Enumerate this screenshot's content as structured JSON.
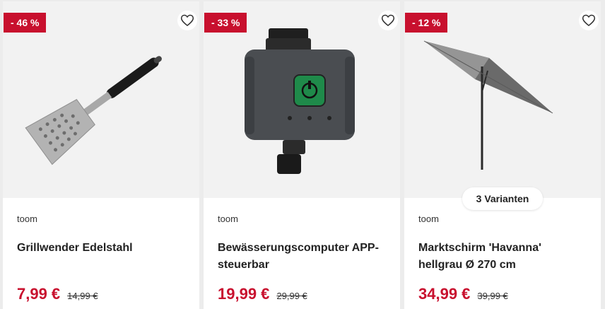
{
  "products": [
    {
      "badge": "- 46 %",
      "brand": "toom",
      "title": "Grillwender Edelstahl",
      "price": "7,99 €",
      "old_price": "14,99 €",
      "image_icon": "spatula-image"
    },
    {
      "badge": "- 33 %",
      "brand": "toom",
      "title": "Bewässerungscomputer APP-steuerbar",
      "price": "19,99 €",
      "old_price": "29,99 €",
      "image_icon": "irrigation-computer-image"
    },
    {
      "badge": "- 12 %",
      "brand": "toom",
      "title": "Marktschirm 'Havanna' hellgrau Ø 270 cm",
      "price": "34,99 €",
      "old_price": "39,99 €",
      "variants": "3 Varianten",
      "image_icon": "umbrella-image"
    }
  ],
  "colors": {
    "badge_bg": "#c8102e",
    "price": "#c8102e",
    "image_bg": "#f2f2f2",
    "page_bg": "#ececec"
  }
}
